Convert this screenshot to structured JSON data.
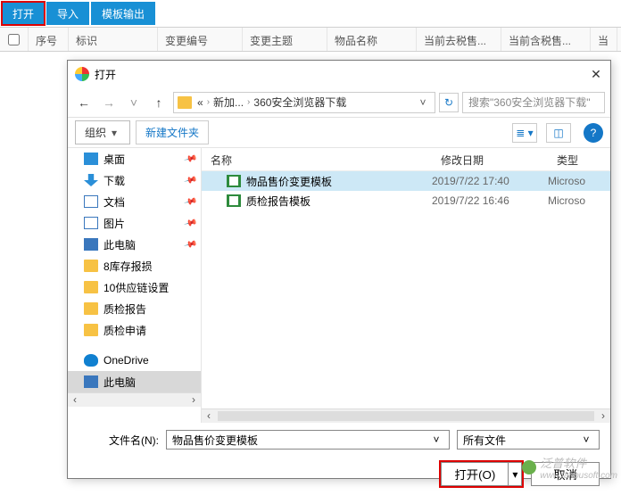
{
  "toolbar": {
    "open": "打开",
    "import": "导入",
    "template": "模板输出"
  },
  "grid": {
    "seq": "序号",
    "mark": "标识",
    "changeNo": "变更编号",
    "subject": "变更主题",
    "itemName": "物品名称",
    "priceExcl": "当前去税售...",
    "priceIncl": "当前含税售...",
    "more": "当"
  },
  "dialog": {
    "title": "打开",
    "breadcrumb": {
      "p1": "«",
      "p2": "新加...",
      "p3": "360安全浏览器下载"
    },
    "searchPlaceholder": "搜索\"360安全浏览器下载\"",
    "organize": "组织",
    "newFolder": "新建文件夹",
    "tree": [
      {
        "label": "桌面",
        "ico": "ico-desktop",
        "pin": true
      },
      {
        "label": "下载",
        "ico": "ico-download",
        "pin": true
      },
      {
        "label": "文档",
        "ico": "ico-docs",
        "pin": true
      },
      {
        "label": "图片",
        "ico": "ico-pics",
        "pin": true
      },
      {
        "label": "此电脑",
        "ico": "ico-pc",
        "pin": true
      },
      {
        "label": "8库存报损",
        "ico": "ico-folder"
      },
      {
        "label": "10供应链设置",
        "ico": "ico-folder"
      },
      {
        "label": "质检报告",
        "ico": "ico-folder"
      },
      {
        "label": "质检申请",
        "ico": "ico-folder"
      },
      {
        "label": "OneDrive",
        "ico": "ico-cloud"
      },
      {
        "label": "此电脑",
        "ico": "ico-pc",
        "sel": true
      }
    ],
    "fileHead": {
      "name": "名称",
      "date": "修改日期",
      "type": "类型"
    },
    "files": [
      {
        "name": "物品售价变更模板",
        "date": "2019/7/22 17:40",
        "type": "Microso",
        "sel": true
      },
      {
        "name": "质检报告模板",
        "date": "2019/7/22 16:46",
        "type": "Microso"
      }
    ],
    "fileLabel": "文件名(N):",
    "fileName": "物品售价变更模板",
    "filter": "所有文件",
    "openBtn": "打开(O)",
    "cancelBtn": "取消"
  },
  "watermark": {
    "text": "泛普软件",
    "url": "www.fanpusoft.com"
  }
}
